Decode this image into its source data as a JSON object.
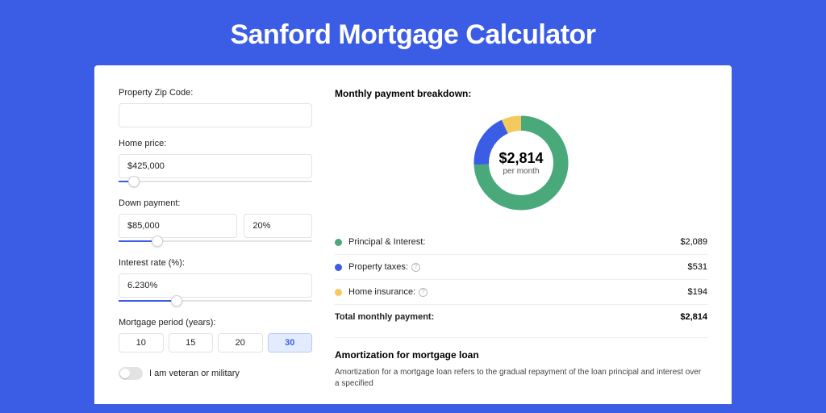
{
  "title": "Sanford Mortgage Calculator",
  "form": {
    "zip": {
      "label": "Property Zip Code:",
      "value": ""
    },
    "price": {
      "label": "Home price:",
      "value": "$425,000",
      "slider_pct": 8
    },
    "down": {
      "label": "Down payment:",
      "value": "$85,000",
      "pct": "20%",
      "slider_pct": 20
    },
    "rate": {
      "label": "Interest rate (%):",
      "value": "6.230%",
      "slider_pct": 30
    },
    "period": {
      "label": "Mortgage period (years):",
      "options": [
        "10",
        "15",
        "20",
        "30"
      ],
      "active": "30"
    },
    "veteran": {
      "label": "I am veteran or military",
      "on": false
    }
  },
  "breakdown": {
    "title": "Monthly payment breakdown:",
    "total_amount": "$2,814",
    "total_sub": "per month",
    "items": [
      {
        "label": "Principal & Interest:",
        "value": "$2,089",
        "color": "#49A97A",
        "info": false
      },
      {
        "label": "Property taxes:",
        "value": "$531",
        "color": "#3B5CE4",
        "info": true
      },
      {
        "label": "Home insurance:",
        "value": "$194",
        "color": "#F4C95D",
        "info": true
      }
    ],
    "total_row": {
      "label": "Total monthly payment:",
      "value": "$2,814"
    }
  },
  "chart_data": {
    "type": "pie",
    "title": "Monthly payment breakdown",
    "series": [
      {
        "name": "Principal & Interest",
        "value": 2089,
        "color": "#49A97A"
      },
      {
        "name": "Property taxes",
        "value": 531,
        "color": "#3B5CE4"
      },
      {
        "name": "Home insurance",
        "value": 194,
        "color": "#F4C95D"
      }
    ],
    "center_label": "$2,814",
    "center_sub": "per month"
  },
  "amortization": {
    "title": "Amortization for mortgage loan",
    "text": "Amortization for a mortgage loan refers to the gradual repayment of the loan principal and interest over a specified"
  }
}
